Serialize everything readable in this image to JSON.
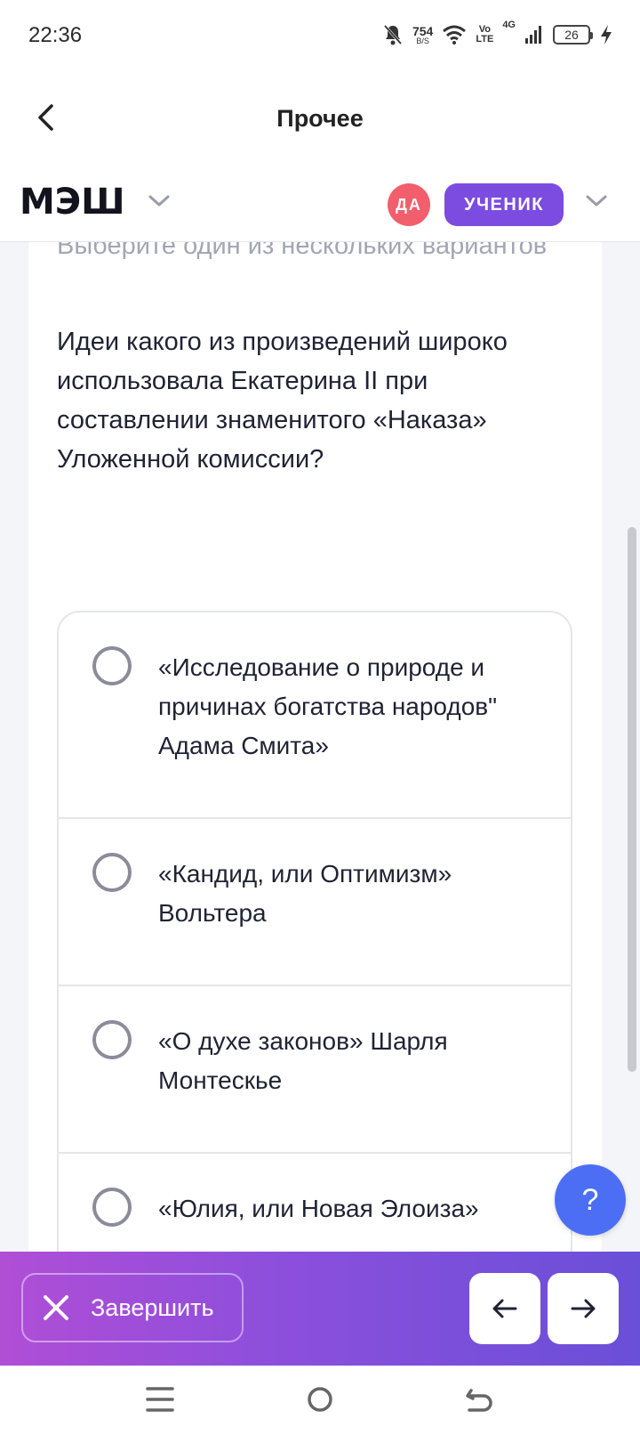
{
  "status_bar": {
    "time": "22:36",
    "net_speed": "754",
    "net_unit": "B/S",
    "volte_top": "Vo",
    "volte_bottom": "LTE",
    "network": "4G",
    "battery": "26"
  },
  "header": {
    "title": "Прочее"
  },
  "brand": {
    "logo": "МЭШ",
    "avatar_initials": "ДА",
    "role": "УЧЕНИК",
    "avatar_color": "#f25e6b",
    "role_color": "#7c4ce0"
  },
  "task": {
    "hint": "Выберите один из нескольких вариантов",
    "question": "Идеи какого из произведений широко использовала Екатерина II при составлении знаменитого «Наказа» Уложенной комиссии?",
    "options": [
      {
        "label": "«Исследование о природе и причинах богатства народов\" Адама Смита»"
      },
      {
        "label": "«Кандид, или Оптимизм» Вольтера"
      },
      {
        "label": "«О духе законов» Шарля Монтескье"
      },
      {
        "label": "«Юлия, или Новая Элоиза»"
      }
    ]
  },
  "help": {
    "label": "?",
    "color": "#4c6ef5"
  },
  "footer": {
    "finish_label": "Завершить",
    "prev_icon": "arrow-left-icon",
    "next_icon": "arrow-right-icon"
  }
}
